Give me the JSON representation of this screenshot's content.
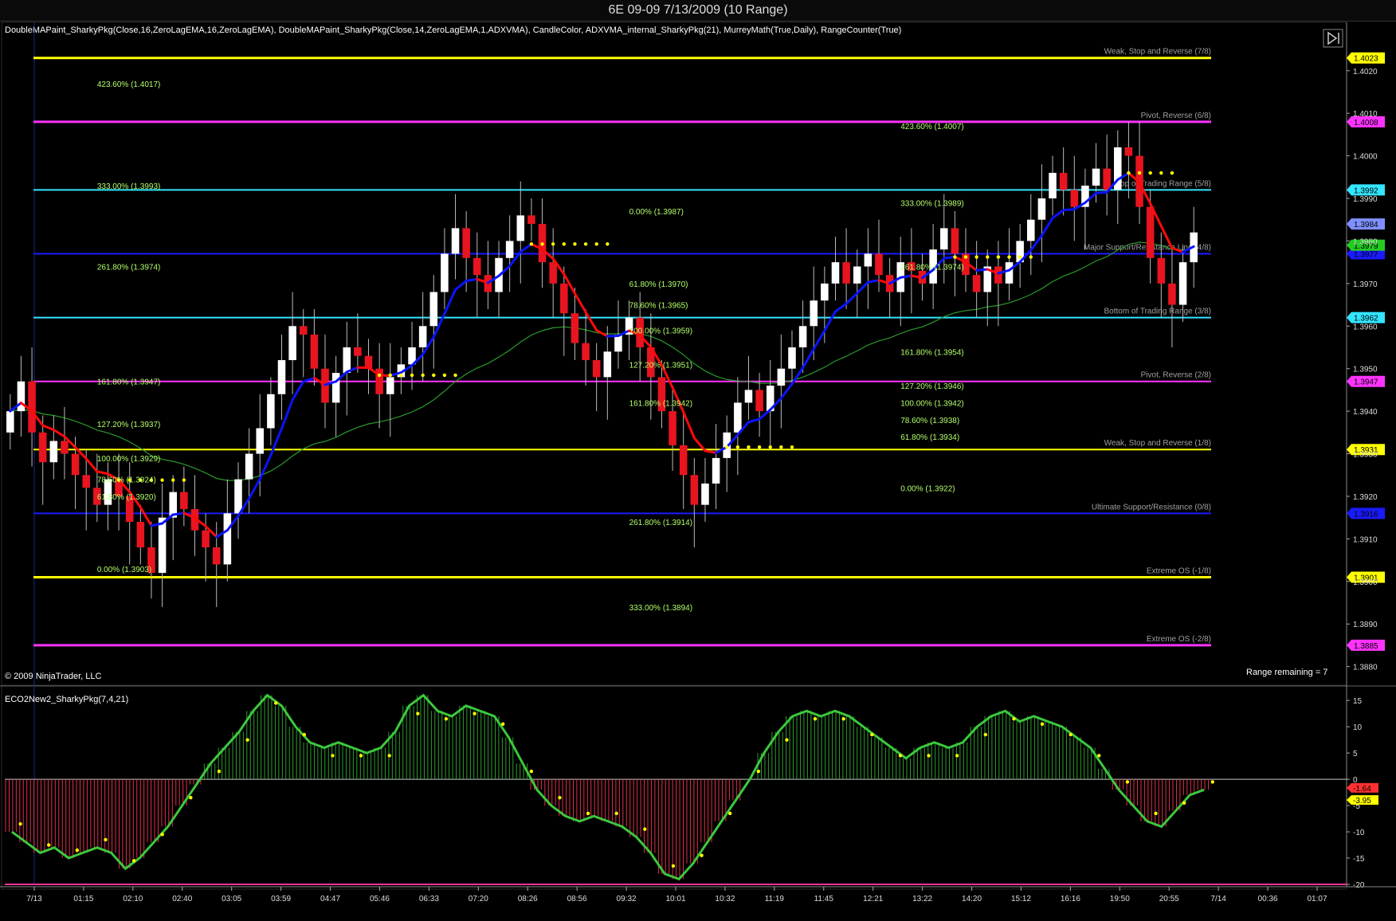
{
  "window": {
    "title": "6E 09-09  7/13/2009 (10 Range)"
  },
  "indicators_text": "DoubleMAPaint_SharkyPkg(Close,16,ZeroLagEMA,16,ZeroLagEMA),  DoubleMAPaint_SharkyPkg(Close,14,ZeroLagEMA,1,ADXVMA),  CandleColor,  ADXVMA_internal_SharkyPkg(21),  MurreyMath(True,Daily),  RangeCounter(True)",
  "copyright": "© 2009 NinjaTrader, LLC",
  "range_remaining": "Range remaining = 7",
  "lower_panel_label": "ECO2New2_SharkyPkg(7,4,21)",
  "colors": {
    "up_candle": "#ffffff",
    "down_candle": "#e8141f",
    "fast_ma_up": "#0a14ff",
    "fast_ma_down": "#ff0a0a",
    "adxvma": "#2a9a2a",
    "yellow_dots": "#ffff00",
    "fib_text": "#b4ff6a",
    "murrey_label": "#a0a0a0"
  },
  "icons": {
    "panel_toggle": "play-pause-icon"
  },
  "murrey_lines": [
    {
      "label": "Weak, Stop and Reverse (7/8)",
      "price": 1.4023,
      "price_text": "1.4023",
      "color": "#ffff00"
    },
    {
      "label": "Pivot, Reverse (6/8)",
      "price": 1.4008,
      "price_text": "1.4008",
      "color": "#ff33ff"
    },
    {
      "label": "Top of Trading Range (5/8)",
      "price": 1.3992,
      "price_text": "1.3992",
      "color": "#33e5ff"
    },
    {
      "label": "Major Support/Resistance Line (4/8)",
      "price": 1.3977,
      "price_text": "1.3977",
      "color": "#1a1aff"
    },
    {
      "label": "Bottom of Trading Range (3/8)",
      "price": 1.3962,
      "price_text": "1.3962",
      "color": "#33e5ff"
    },
    {
      "label": "Pivot, Reverse (2/8)",
      "price": 1.3947,
      "price_text": "1.3947",
      "color": "#ff33ff"
    },
    {
      "label": "Weak, Stop and Reverse (1/8)",
      "price": 1.3931,
      "price_text": "1.3931",
      "color": "#ffff00"
    },
    {
      "label": "Ultimate Support/Resistance (0/8)",
      "price": 1.3916,
      "price_text": "1.3916",
      "color": "#1a1aff"
    },
    {
      "label": "Extreme OS (-1/8)",
      "price": 1.3901,
      "price_text": "1.3901",
      "color": "#ffff00"
    },
    {
      "label": "Extreme OS (-2/8)",
      "price": 1.3885,
      "price_text": "1.3885",
      "color": "#ff33ff"
    }
  ],
  "extra_price_tags": [
    {
      "price": 1.3984,
      "text": "1.3984",
      "color": "#7f8fff"
    },
    {
      "price": 1.3979,
      "text": "1.3979",
      "color": "#22cc22"
    }
  ],
  "price_axis_ticks": [
    "1.4020",
    "1.4010",
    "1.4000",
    "1.3990",
    "1.3980",
    "1.3970",
    "1.3960",
    "1.3950",
    "1.3940",
    "1.3930",
    "1.3920",
    "1.3910",
    "1.3900",
    "1.3890",
    "1.3880"
  ],
  "osc_axis_ticks": [
    "15",
    "10",
    "5",
    "0",
    "-5",
    "-10",
    "-15",
    "-20"
  ],
  "osc_tags": [
    {
      "value": -1.64,
      "text": "-1.64",
      "color": "#ff3030"
    },
    {
      "value": -3.95,
      "text": "-3.95",
      "color": "#ffff00"
    }
  ],
  "time_labels": [
    "7/13",
    "01:15",
    "02:10",
    "02:40",
    "03:05",
    "03:59",
    "04:47",
    "05:46",
    "06:33",
    "07:20",
    "08:26",
    "08:56",
    "09:32",
    "10:01",
    "10:32",
    "11:19",
    "11:45",
    "12:21",
    "13:22",
    "14:20",
    "15:12",
    "16:16",
    "19:50",
    "20:55",
    "7/14",
    "00:36",
    "01:07"
  ],
  "fib_labels": [
    {
      "text": "423.60% (1.4017)",
      "bar": 8
    },
    {
      "text": "333.00% (1.3993)",
      "bar": 8
    },
    {
      "text": "261.80% (1.3974)",
      "bar": 8
    },
    {
      "text": "161.80% (1.3947)",
      "bar": 8
    },
    {
      "text": "127.20% (1.3937)",
      "bar": 8
    },
    {
      "text": "100.00% (1.3929)",
      "bar": 8
    },
    {
      "text": "78.60% (1.3924)",
      "bar": 8
    },
    {
      "text": "61.80% (1.3920)",
      "bar": 8
    },
    {
      "text": "0.00% (1.3903)",
      "bar": 8
    },
    {
      "text": "0.00% (1.3987)",
      "bar": 57
    },
    {
      "text": "61.80% (1.3970)",
      "bar": 57
    },
    {
      "text": "78.60% (1.3965)",
      "bar": 57
    },
    {
      "text": "100.00% (1.3959)",
      "bar": 57
    },
    {
      "text": "127.20% (1.3951)",
      "bar": 57
    },
    {
      "text": "161.80% (1.3942)",
      "bar": 57
    },
    {
      "text": "261.80% (1.3914)",
      "bar": 57
    },
    {
      "text": "333.00% (1.3894)",
      "bar": 57
    },
    {
      "text": "423.60% (1.4007)",
      "bar": 82
    },
    {
      "text": "333.00% (1.3989)",
      "bar": 82
    },
    {
      "text": "261.80% (1.3974)",
      "bar": 82
    },
    {
      "text": "161.80% (1.3954)",
      "bar": 82
    },
    {
      "text": "127.20% (1.3946)",
      "bar": 82
    },
    {
      "text": "100.00% (1.3942)",
      "bar": 82
    },
    {
      "text": "78.60% (1.3938)",
      "bar": 82
    },
    {
      "text": "61.80% (1.3934)",
      "bar": 82
    },
    {
      "text": "0.00% (1.3922)",
      "bar": 82
    }
  ],
  "chart_data": {
    "type": "candlestick",
    "price_range": [
      1.3876,
      1.4031
    ],
    "osc_range": [
      -20,
      17
    ],
    "closes": [
      1.394,
      1.3947,
      1.3935,
      1.3928,
      1.3933,
      1.393,
      1.3925,
      1.3922,
      1.3918,
      1.3924,
      1.392,
      1.3914,
      1.3908,
      1.3902,
      1.3915,
      1.3921,
      1.3917,
      1.3912,
      1.3908,
      1.3904,
      1.3916,
      1.3924,
      1.393,
      1.3936,
      1.3944,
      1.3952,
      1.396,
      1.3958,
      1.395,
      1.3942,
      1.3949,
      1.3955,
      1.3953,
      1.395,
      1.3944,
      1.3948,
      1.3951,
      1.3955,
      1.396,
      1.3968,
      1.3977,
      1.3983,
      1.3976,
      1.3972,
      1.3968,
      1.3976,
      1.398,
      1.3986,
      1.3984,
      1.3975,
      1.397,
      1.3963,
      1.3956,
      1.3952,
      1.3948,
      1.3954,
      1.3958,
      1.3962,
      1.3955,
      1.3948,
      1.394,
      1.3932,
      1.3925,
      1.3918,
      1.3923,
      1.3929,
      1.3935,
      1.3942,
      1.3945,
      1.394,
      1.3946,
      1.395,
      1.3955,
      1.396,
      1.3966,
      1.397,
      1.3975,
      1.397,
      1.3974,
      1.3977,
      1.3972,
      1.3968,
      1.3975,
      1.3973,
      1.397,
      1.3978,
      1.3983,
      1.3977,
      1.3972,
      1.3968,
      1.3974,
      1.397,
      1.3975,
      1.398,
      1.3985,
      1.399,
      1.3996,
      1.3992,
      1.3988,
      1.3993,
      1.3997,
      1.3992,
      1.4002,
      1.4,
      1.3988,
      1.3976,
      1.397,
      1.3965,
      1.3975,
      1.3982
    ],
    "osc_values": [
      -10,
      -12,
      -14,
      -13,
      -15,
      -14,
      -13,
      -14,
      -17,
      -15,
      -12,
      -9,
      -5,
      -1,
      3,
      6,
      9,
      13,
      16,
      14,
      10,
      7,
      6,
      7,
      6,
      5,
      6,
      9,
      14,
      16,
      13,
      12,
      14,
      13,
      12,
      8,
      3,
      -2,
      -5,
      -7,
      -8,
      -7,
      -8,
      -9,
      -11,
      -14,
      -18,
      -19,
      -16,
      -12,
      -8,
      -4,
      0,
      5,
      9,
      12,
      13,
      12,
      13,
      12,
      10,
      8,
      6,
      4,
      6,
      7,
      6,
      7,
      10,
      12,
      13,
      11,
      12,
      11,
      10,
      8,
      6,
      2,
      -2,
      -5,
      -8,
      -9,
      -6,
      -3,
      -2
    ]
  }
}
